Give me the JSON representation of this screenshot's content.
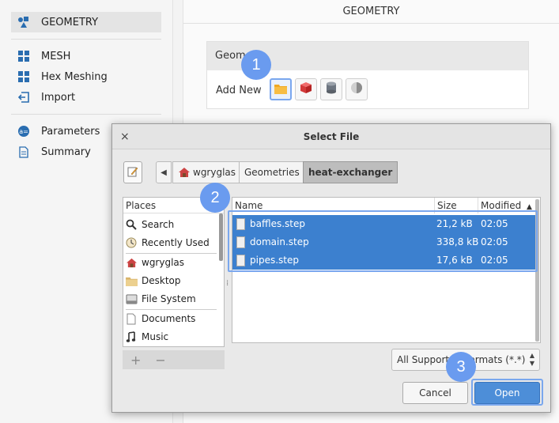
{
  "sidebar": {
    "items": [
      {
        "label": "GEOMETRY",
        "icon": "shapes-icon"
      },
      {
        "label": "MESH",
        "icon": "grid-icon"
      },
      {
        "label": "Hex Meshing",
        "icon": "grid-icon"
      },
      {
        "label": "Import",
        "icon": "import-icon"
      },
      {
        "label": "Parameters",
        "icon": "parameters-icon"
      },
      {
        "label": "Summary",
        "icon": "document-icon"
      }
    ]
  },
  "main": {
    "title": "GEOMETRY",
    "panel_header": "Geome",
    "add_new_label": "Add New",
    "tools": [
      "folder-icon",
      "cube-icon",
      "cylinder-icon",
      "sphere-icon"
    ]
  },
  "badges": [
    "1",
    "2",
    "3"
  ],
  "dialog": {
    "title": "Select File",
    "close": "×",
    "breadcrumb": [
      "wgryglas",
      "Geometries",
      "heat-exchanger"
    ],
    "places_header": "Places",
    "places": [
      "Search",
      "Recently Used",
      "wgryglas",
      "Desktop",
      "File System",
      "Documents",
      "Music"
    ],
    "places_add": "+",
    "places_remove": "−",
    "columns": {
      "name": "Name",
      "size": "Size",
      "modified": "Modified"
    },
    "files": [
      {
        "name": "baffles.step",
        "size": "21,2 kB",
        "modified": "02:05"
      },
      {
        "name": "domain.step",
        "size": "338,8 kB",
        "modified": "02:05"
      },
      {
        "name": "pipes.step",
        "size": "17,6 kB",
        "modified": "02:05"
      }
    ],
    "filter": "All Supported Formats (*.*)",
    "cancel_label": "Cancel",
    "open_label": "Open"
  },
  "colors": {
    "accent": "#6a9bef",
    "selection": "#3c80cf",
    "open_button": "#4d8ed8"
  }
}
